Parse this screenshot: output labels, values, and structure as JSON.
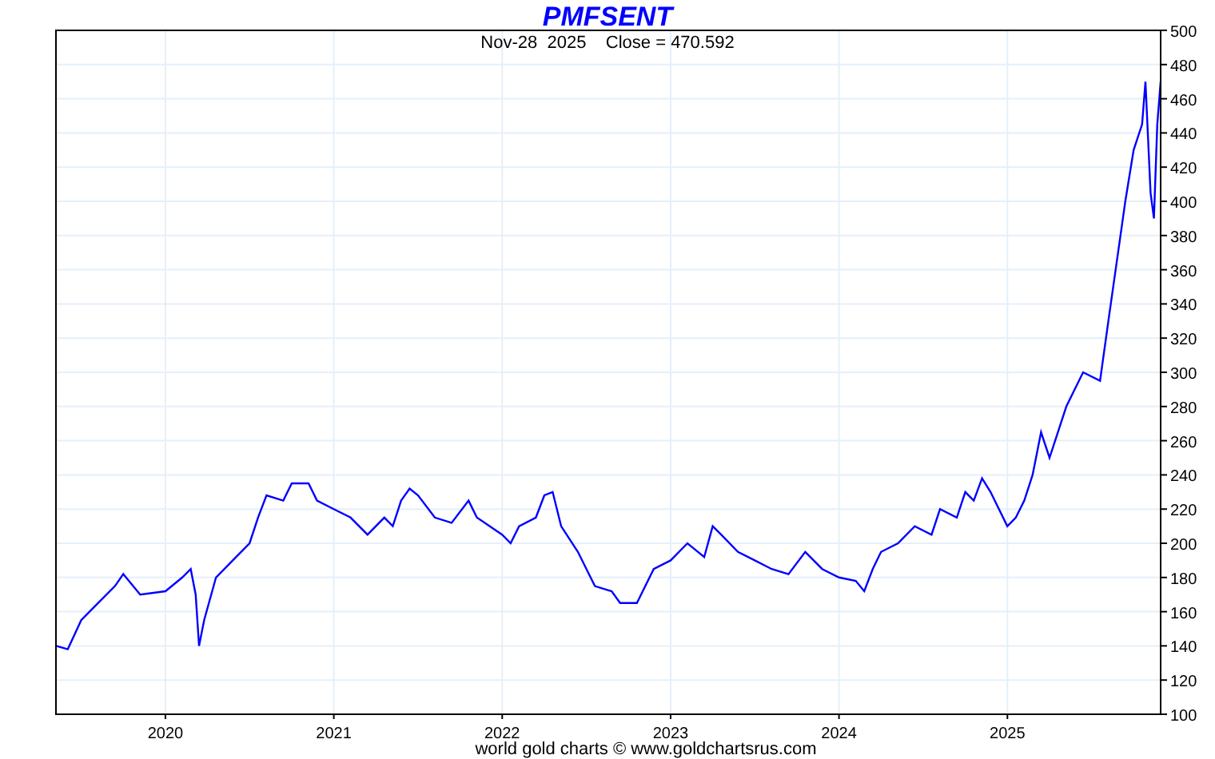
{
  "chart": {
    "chart_data": {
      "type": "line",
      "title": "PMFSENT",
      "x": [
        2019.35,
        2019.42,
        2019.5,
        2019.6,
        2019.7,
        2019.75,
        2019.85,
        2020.0,
        2020.1,
        2020.15,
        2020.18,
        2020.2,
        2020.23,
        2020.3,
        2020.4,
        2020.5,
        2020.55,
        2020.6,
        2020.7,
        2020.75,
        2020.85,
        2020.9,
        2021.0,
        2021.1,
        2021.2,
        2021.3,
        2021.35,
        2021.4,
        2021.45,
        2021.5,
        2021.6,
        2021.7,
        2021.8,
        2021.85,
        2022.0,
        2022.05,
        2022.1,
        2022.2,
        2022.25,
        2022.3,
        2022.35,
        2022.45,
        2022.55,
        2022.65,
        2022.7,
        2022.8,
        2022.9,
        2023.0,
        2023.1,
        2023.2,
        2023.25,
        2023.3,
        2023.4,
        2023.5,
        2023.6,
        2023.7,
        2023.8,
        2023.9,
        2024.0,
        2024.1,
        2024.15,
        2024.2,
        2024.25,
        2024.35,
        2024.45,
        2024.55,
        2024.6,
        2024.7,
        2024.75,
        2024.8,
        2024.85,
        2024.9,
        2025.0,
        2025.05,
        2025.1,
        2025.15,
        2025.2,
        2025.25,
        2025.35,
        2025.45,
        2025.55,
        2025.6,
        2025.7,
        2025.75,
        2025.8,
        2025.82,
        2025.85,
        2025.87,
        2025.89,
        2025.91
      ],
      "series": [
        {
          "color": "#0000ff",
          "values": [
            140,
            138,
            155,
            165,
            175,
            182,
            170,
            172,
            180,
            185,
            170,
            140,
            155,
            180,
            190,
            200,
            215,
            228,
            225,
            235,
            235,
            225,
            220,
            215,
            205,
            215,
            210,
            225,
            232,
            228,
            215,
            212,
            225,
            215,
            205,
            200,
            210,
            215,
            228,
            230,
            210,
            195,
            175,
            172,
            165,
            165,
            185,
            190,
            200,
            192,
            210,
            205,
            195,
            190,
            185,
            182,
            195,
            185,
            180,
            178,
            172,
            185,
            195,
            200,
            210,
            205,
            220,
            215,
            230,
            225,
            238,
            230,
            210,
            215,
            225,
            240,
            265,
            250,
            280,
            300,
            295,
            330,
            400,
            430,
            445,
            470,
            405,
            390,
            445,
            470
          ]
        }
      ],
      "xlim": [
        2019.35,
        2025.91
      ],
      "ylim": [
        100,
        500
      ],
      "xticks": [
        2020,
        2021,
        2022,
        2023,
        2024,
        2025
      ],
      "grid": true,
      "yticks": [
        100,
        120,
        140,
        160,
        180,
        200,
        220,
        240,
        260,
        280,
        300,
        320,
        340,
        360,
        380,
        400,
        420,
        440,
        460,
        480,
        500
      ]
    },
    "subtitle": "Nov-28  2025    Close = 470.592"
  },
  "footer": "world gold charts © www.goldchartsrus.com"
}
